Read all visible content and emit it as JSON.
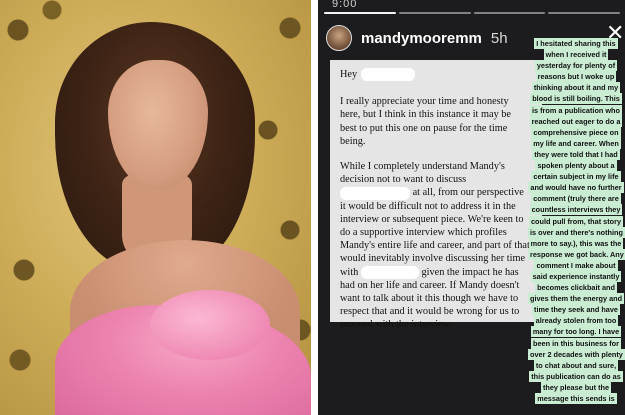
{
  "story": {
    "status_time": "9:00",
    "username": "mandymooremm",
    "time_ago": "5h",
    "progress_segments": 4,
    "active_segment": 0
  },
  "letter": {
    "greeting": "Hey",
    "para1": "I really appreciate your time and honesty here, but I think in this instance it may be best to put this one on pause for the time being.",
    "para2_a": "While I completely understand Mandy's decision not to want to discuss",
    "para2_b": "at all, from our perspective it would be difficult not to address it in the interview or subsequent piece. We're keen to do a supportive interview which profiles Mandy's entire life and career, and part of that would inevitably involve discussing her time with",
    "para2_c": "given the impact he has had on her life and career. If Mandy doesn't want to talk about it this though we have to respect that and it would be wrong for us to proceed with the interview."
  },
  "caption": "I hesitated sharing this when I received it yesterday for plenty of reasons but I woke up thinking about it and my blood is still boiling. This is from a publication who reached out eager to do a comprehensive piece on my life and career. When they were told that I had spoken plenty about a certain subject in my life and would have no further comment (truly there are countless interviews they could pull from, that story is over and there's nothing more to say.), this was the response we got back. Any comment I make about said experience instantly becomes clickbait and gives them the energy and time they seek and have already stolen from too many for too long. I have been in this business for over 2 decades with plenty to chat about and sure, this publication can do as they please but the message this sends is",
  "colors": {
    "story_bg": "#1c1c1e",
    "letter_bg": "#e5e5e5",
    "caption_highlight": "#c9ecd3",
    "dress_pink": "#ec82ae",
    "backdrop_gold": "#cfae5a"
  }
}
